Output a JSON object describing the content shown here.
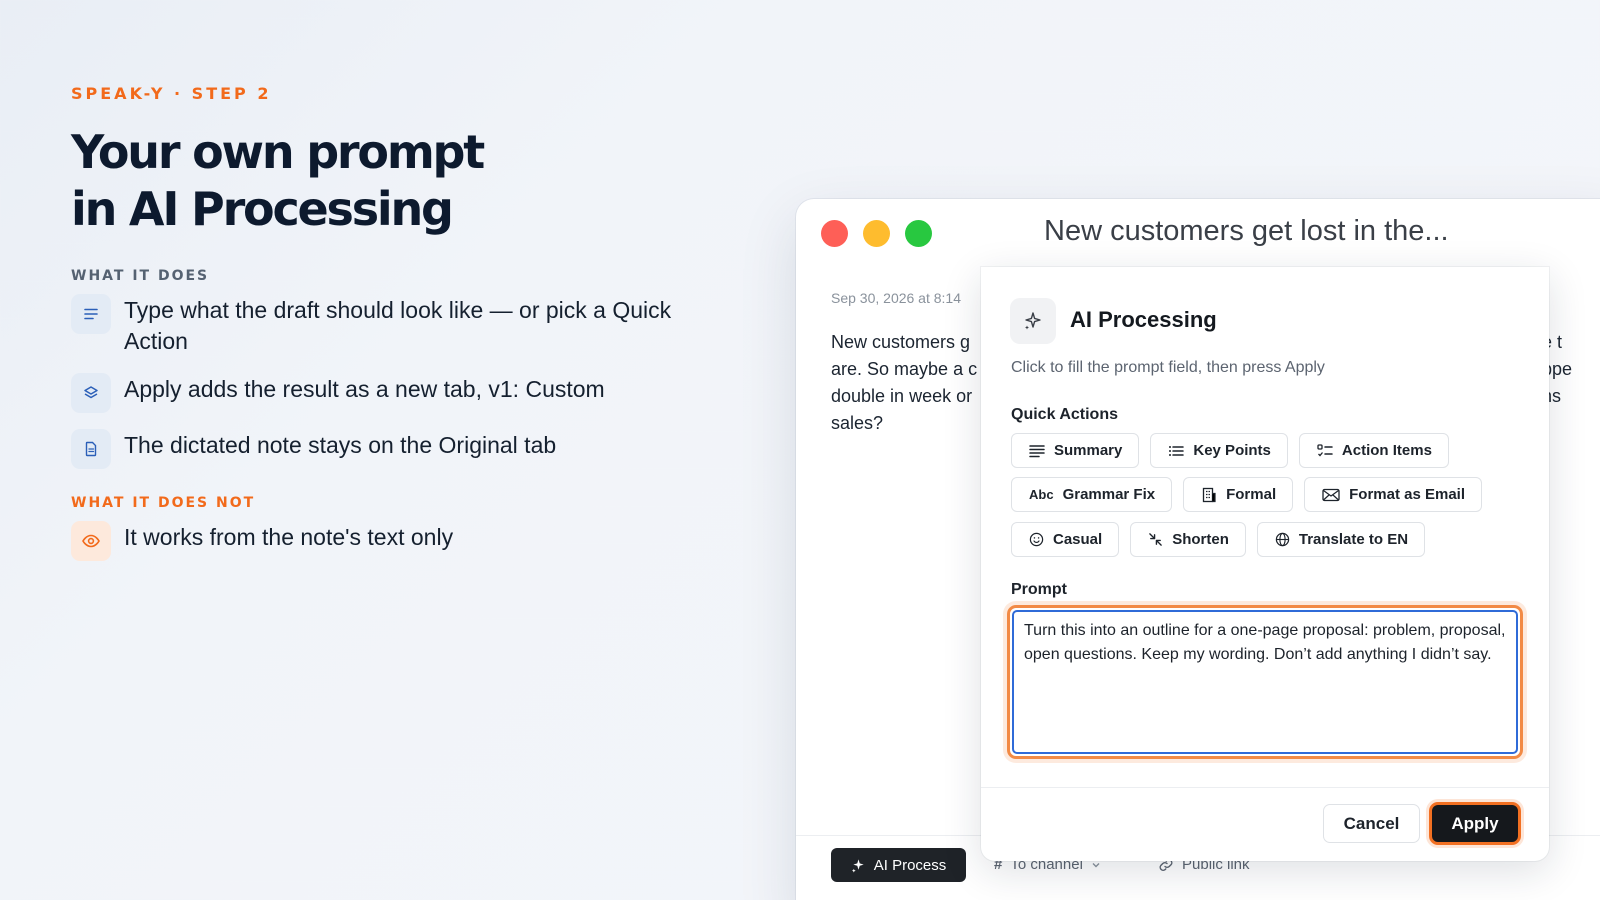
{
  "eyebrow": "SPEAK-Y · STEP 2",
  "headline": {
    "line1": "Your own prompt",
    "line2": "in AI Processing"
  },
  "what_it_does": {
    "label": "WHAT IT DOES",
    "items": [
      {
        "icon": "text-lines-icon",
        "text": "Type what the draft should look like — or pick a Quick Action"
      },
      {
        "icon": "layers-icon",
        "text": "Apply adds the result as a new tab, v1: Custom"
      },
      {
        "icon": "document-icon",
        "text": "The dictated note stays on the Original tab"
      }
    ]
  },
  "what_it_does_not": {
    "label": "WHAT IT DOES NOT",
    "items": [
      {
        "icon": "eye-icon",
        "text": "It works from the note's text only"
      }
    ]
  },
  "window": {
    "title": "New customers get lost in the...",
    "note_date": "Sep 30, 2026 at 8:14",
    "note_body": "New customers g are. So maybe a c double in week or sales?",
    "note_right_fragment": "e t ppe ns",
    "bottom_bar": {
      "ai_process": "AI Process",
      "to_channel": "To channel",
      "public_link": "Public link"
    }
  },
  "modal": {
    "title": "AI Processing",
    "subtitle": "Click to fill the prompt field, then press Apply",
    "quick_actions_label": "Quick Actions",
    "quick_actions": [
      {
        "label": "Summary",
        "icon": "lines-icon"
      },
      {
        "label": "Key Points",
        "icon": "list-icon"
      },
      {
        "label": "Action Items",
        "icon": "checklist-icon"
      },
      {
        "label": "Grammar Fix",
        "icon": "abc-icon",
        "icon_text": "Abc"
      },
      {
        "label": "Formal",
        "icon": "building-icon"
      },
      {
        "label": "Format as Email",
        "icon": "mail-icon"
      },
      {
        "label": "Casual",
        "icon": "smile-icon"
      },
      {
        "label": "Shorten",
        "icon": "shrink-icon"
      },
      {
        "label": "Translate to EN",
        "icon": "globe-icon"
      }
    ],
    "prompt_label": "Prompt",
    "prompt_value": "Turn this into an outline for a one-page proposal: problem, proposal, open questions. Keep my wording. Don’t add anything I didn’t say.",
    "cancel": "Cancel",
    "apply": "Apply"
  },
  "colors": {
    "accent": "#f26a1b",
    "headline": "#0d1a2e",
    "focus_blue": "#2f6bd8",
    "dark_button": "#15181c"
  }
}
